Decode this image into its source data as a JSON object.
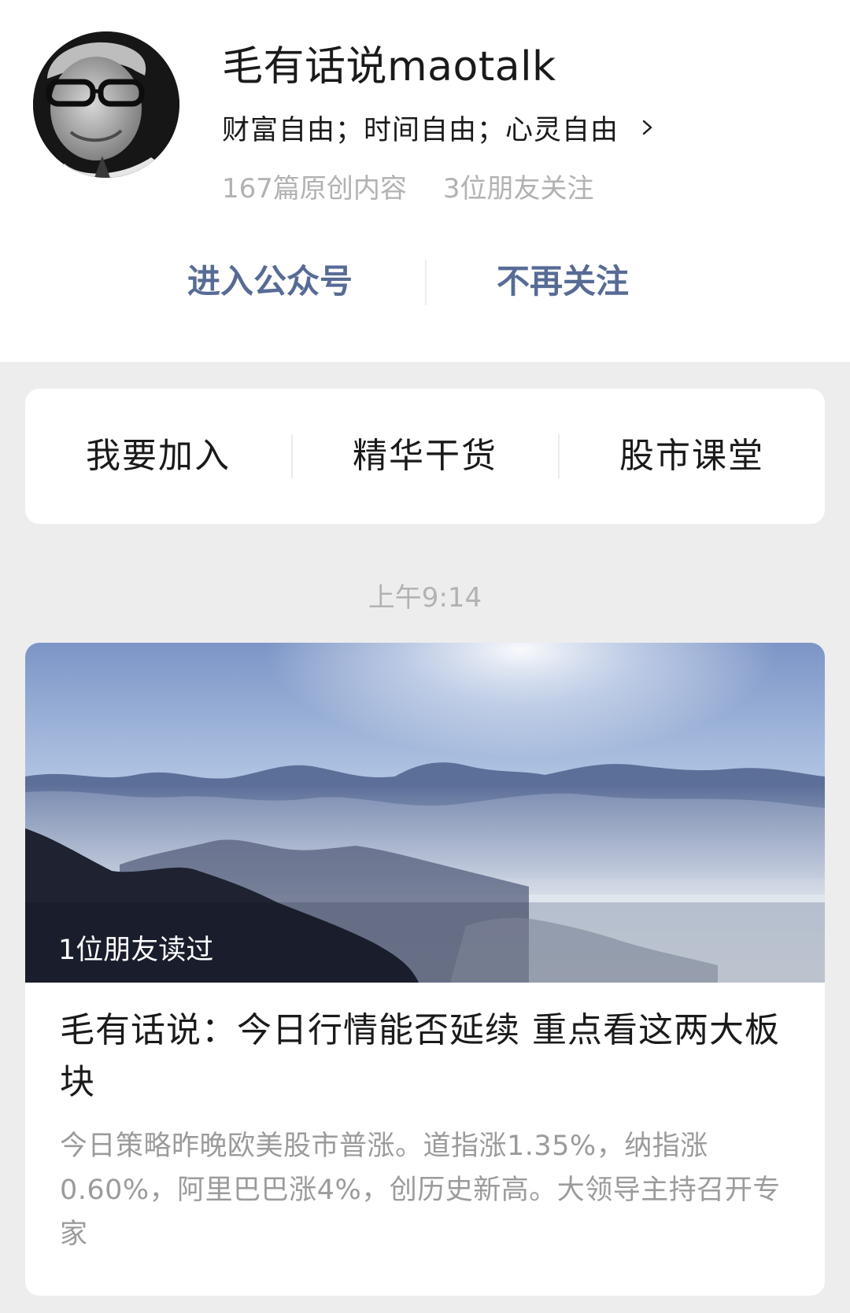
{
  "profile": {
    "name": "毛有话说maotalk",
    "slogan": "财富自由；时间自由；心灵自由",
    "original_count": "167篇原创内容",
    "friends_following": "3位朋友关注"
  },
  "actions": {
    "enter": "进入公众号",
    "unfollow": "不再关注"
  },
  "menu": {
    "items": [
      {
        "label": "我要加入"
      },
      {
        "label": "精华干货"
      },
      {
        "label": "股市课堂"
      }
    ]
  },
  "feed": {
    "timestamp": "上午9:14",
    "article": {
      "read_badge": "1位朋友读过",
      "title": "毛有话说：今日行情能否延续 重点看这两大板块",
      "digest": "今日策略昨晚欧美股市普涨。道指涨1.35%，纳指涨0.60%，阿里巴巴涨4%，创历史新高。大领导主持召开专家"
    }
  },
  "colors": {
    "page_background": "#ededed",
    "card_background": "#ffffff",
    "link_blue": "#576b95",
    "primary_text": "#1a1a1a",
    "secondary_text": "#b2b2b2"
  },
  "icons": {
    "chevron": "chevron-right-icon",
    "avatar": "avatar-portrait"
  }
}
